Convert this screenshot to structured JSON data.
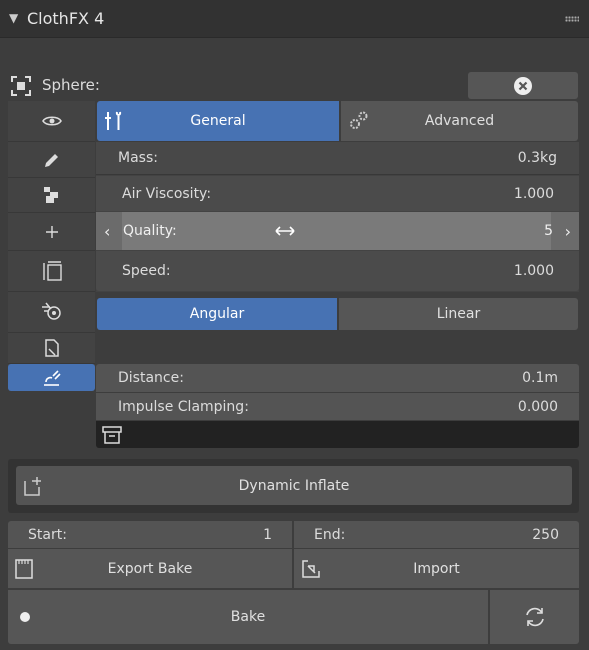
{
  "header": {
    "title": "ClothFX 4"
  },
  "object": {
    "label": "Sphere:"
  },
  "tabs": {
    "general": "General",
    "advanced": "Advanced"
  },
  "fields": {
    "mass": {
      "label": "Mass:",
      "value": "0.3kg"
    },
    "air_viscosity": {
      "label": "Air Viscosity:",
      "value": "1.000"
    },
    "quality": {
      "label": "Quality:",
      "value": "5"
    },
    "speed": {
      "label": "Speed:",
      "value": "1.000"
    }
  },
  "mode_tabs": {
    "angular": "Angular",
    "linear": "Linear"
  },
  "damping": {
    "distance": {
      "label": "Distance:",
      "value": "0.1m"
    },
    "impulse": {
      "label": "Impulse Clamping:",
      "value": "0.000"
    }
  },
  "dynamic_inflate": "Dynamic Inflate",
  "range": {
    "start_label": "Start:",
    "start_value": "1",
    "end_label": "End:",
    "end_value": "250"
  },
  "actions": {
    "export": "Export Bake",
    "import": "Import",
    "bake": "Bake"
  },
  "colors": {
    "accent": "#4772b3",
    "field": "#545454",
    "panel": "#434343"
  }
}
